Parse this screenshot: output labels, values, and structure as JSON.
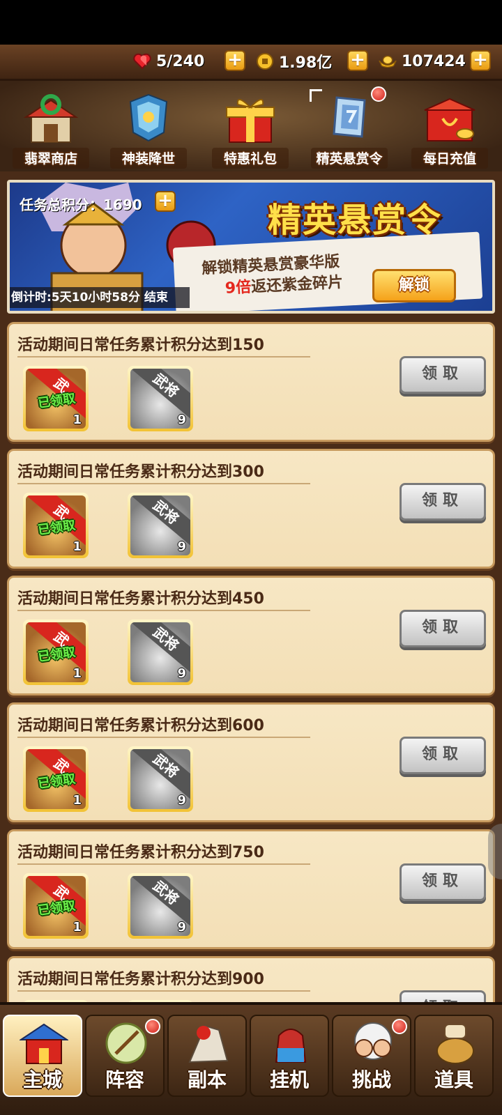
{
  "resources": [
    {
      "icon": "heart-stamina-icon",
      "value": "5/240"
    },
    {
      "icon": "copper-coin-icon",
      "value": "1.98亿"
    },
    {
      "icon": "gold-ingot-icon",
      "value": "107424"
    }
  ],
  "events": [
    {
      "label": "翡翠商店",
      "icon": "jade-shop-icon"
    },
    {
      "label": "神装降世",
      "icon": "divine-armor-icon"
    },
    {
      "label": "特惠礼包",
      "icon": "gift-box-icon"
    },
    {
      "label": "精英悬赏令",
      "icon": "bounty-token-icon"
    },
    {
      "label": "每日充值",
      "icon": "daily-recharge-icon"
    }
  ],
  "banner": {
    "score_label": "任务总积分：1690",
    "title": "精英悬赏令",
    "line1": "解锁精英悬赏豪华版",
    "line2_highlight": "9倍",
    "line2_rest": "返还紫金碎片",
    "unlock_label": "解锁",
    "countdown": "倒计时:5天10小时58分 结束"
  },
  "rewards_common": {
    "chest_ribbon": "武",
    "claimed_label": "已领取",
    "chest_qty": "1",
    "piece_ribbon": "武将",
    "piece_qty": "9",
    "claim_label": "领取"
  },
  "tasks": [
    {
      "title": "活动期间日常任务累计积分达到150"
    },
    {
      "title": "活动期间日常任务累计积分达到300"
    },
    {
      "title": "活动期间日常任务累计积分达到450"
    },
    {
      "title": "活动期间日常任务累计积分达到600"
    },
    {
      "title": "活动期间日常任务累计积分达到750"
    },
    {
      "title": "活动期间日常任务累计积分达到900"
    }
  ],
  "nav": [
    {
      "label": "主城",
      "icon": "main-city-icon",
      "active": true
    },
    {
      "label": "阵容",
      "icon": "formation-icon",
      "active": false
    },
    {
      "label": "副本",
      "icon": "dungeon-icon",
      "active": false
    },
    {
      "label": "挂机",
      "icon": "idle-icon",
      "active": false
    },
    {
      "label": "挑战",
      "icon": "challenge-icon",
      "active": false
    },
    {
      "label": "道具",
      "icon": "items-icon",
      "active": false
    }
  ],
  "colors": {
    "accent_gold": "#f5a21a",
    "highlight_red": "#e4281e",
    "claimed_green": "#6cf04a"
  }
}
